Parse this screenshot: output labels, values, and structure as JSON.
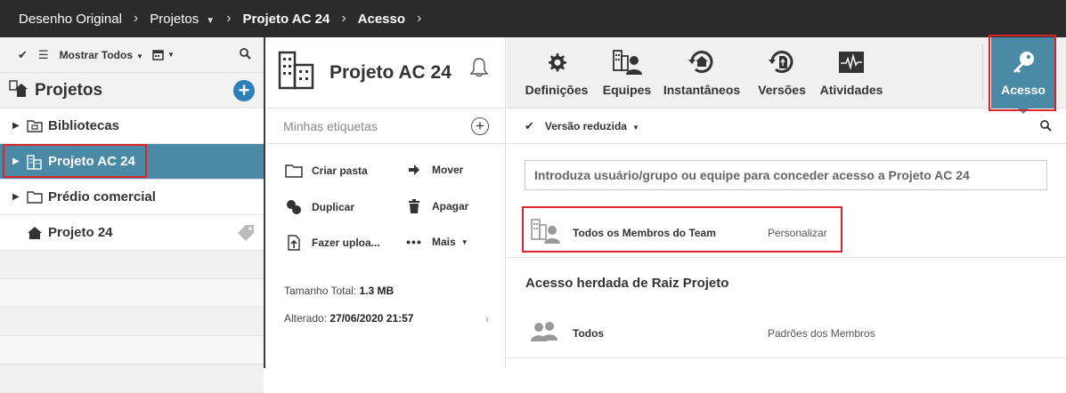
{
  "breadcrumb": {
    "items": [
      "Desenho Original",
      "Projetos",
      "Projeto AC 24",
      "Acesso"
    ]
  },
  "sidebar": {
    "toolbar": {
      "filter_label": "Mostrar Todos"
    },
    "title": "Projetos",
    "items": [
      {
        "label": "Bibliotecas",
        "icon": "library-folder-icon"
      },
      {
        "label": "Projeto AC 24",
        "icon": "building-icon",
        "selected": true
      },
      {
        "label": "Prédio comercial",
        "icon": "folder-icon"
      },
      {
        "label": "Projeto 24",
        "icon": "house-icon"
      }
    ]
  },
  "project": {
    "title": "Projeto AC 24",
    "tags_placeholder": "Minhas etiquetas",
    "actions": {
      "create_folder": "Criar pasta",
      "move": "Mover",
      "duplicate": "Duplicar",
      "delete": "Apagar",
      "upload": "Fazer uploa...",
      "more": "Mais"
    },
    "total_size_label": "Tamanho Total:",
    "total_size_value": "1.3 MB",
    "modified_label": "Alterado:",
    "modified_value": "27/06/2020 21:57"
  },
  "tabs": {
    "settings": "Definições",
    "teams": "Equipes",
    "snapshots": "Instantâneos",
    "versions": "Versões",
    "activities": "Atividades",
    "access": "Acesso"
  },
  "access": {
    "view_label": "Versão reduzida",
    "grant_placeholder": "Introduza usuário/grupo ou equipe para conceder acesso a Projeto AC 24",
    "team_row": {
      "name": "Todos os Membros do Team",
      "permission": "Personalizar"
    },
    "inherited_title": "Acesso herdada de Raiz Projeto",
    "inherited_row": {
      "name": "Todos",
      "permission": "Padrões dos Membros"
    }
  },
  "colors": {
    "topbar": "#2b2b2b",
    "accent": "#4a8aa6",
    "highlight": "#d9252a",
    "add_button": "#2d7fb8"
  }
}
